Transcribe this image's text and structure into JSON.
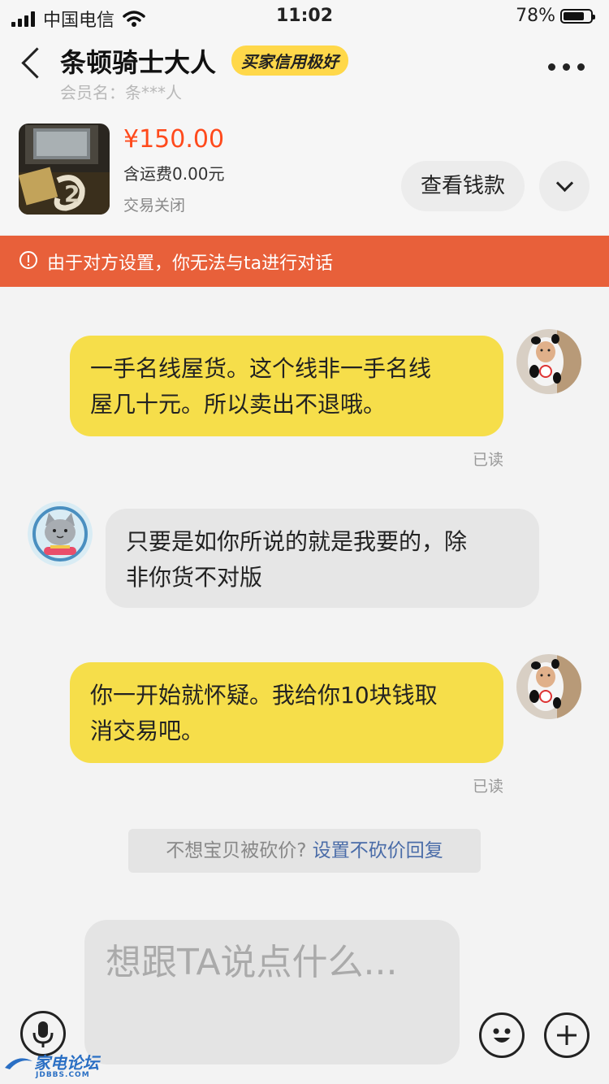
{
  "status_bar": {
    "carrier": "中国电信",
    "time": "11:02",
    "battery": "78%",
    "battery_level": 0.78
  },
  "header": {
    "name": "条顿骑士大人",
    "badge": "买家信用极好",
    "member": "会员名：条***人"
  },
  "product": {
    "price": "¥150.00",
    "shipping": "含运费0.00元",
    "status": "交易关闭",
    "view_payment": "查看钱款"
  },
  "alert": {
    "text": "由于对方设置，你无法与ta进行对话"
  },
  "messages": [
    {
      "side": "me",
      "lines": [
        "一手名线屋货。这个线非一手名线",
        "屋几十元。所以卖出不退哦。"
      ],
      "read": "已读"
    },
    {
      "side": "them",
      "lines": [
        "只要是如你所说的就是我要的，除",
        "非你货不对版"
      ]
    },
    {
      "side": "me",
      "lines": [
        "你一开始就怀疑。我给你10块钱取",
        "消交易吧。"
      ],
      "read": "已读"
    }
  ],
  "hint": {
    "text": "不想宝贝被砍价? ",
    "link": "设置不砍价回复"
  },
  "input": {
    "placeholder": "想跟TA说点什么..."
  },
  "watermark": {
    "name": "家电论坛",
    "url": "JDBBS.COM"
  },
  "colors": {
    "accent": "#ff4a1c",
    "alert_bg": "#e8603a",
    "my_bubble": "#f6de4a",
    "their_bubble": "#e6e6e6",
    "badge": "#ffd84a",
    "link": "#4a6ca8"
  }
}
